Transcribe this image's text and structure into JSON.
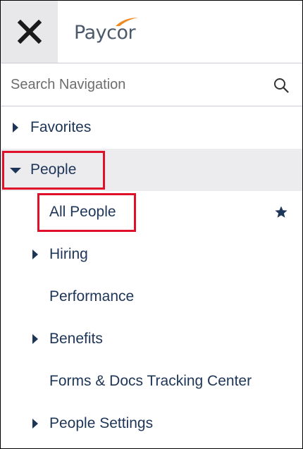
{
  "header": {
    "close_icon": "close-icon",
    "logo_text": "Paycor"
  },
  "search": {
    "placeholder": "Search Navigation",
    "value": "",
    "icon": "search-icon"
  },
  "nav": {
    "favorites": {
      "label": "Favorites",
      "icon": "caret-right-icon"
    },
    "people": {
      "label": "People",
      "icon": "caret-down-icon",
      "expanded": true,
      "active": true
    },
    "children": {
      "all_people": {
        "label": "All People",
        "favorited": true,
        "icon": "star-icon"
      },
      "hiring": {
        "label": "Hiring",
        "icon": "caret-right-icon"
      },
      "performance": {
        "label": "Performance"
      },
      "benefits": {
        "label": "Benefits",
        "icon": "caret-right-icon"
      },
      "forms_docs": {
        "label": "Forms & Docs Tracking Center"
      },
      "people_settings": {
        "label": "People Settings",
        "icon": "caret-right-icon"
      }
    }
  },
  "colors": {
    "text": "#1d3557",
    "highlight": "#e0102a",
    "active_row": "#ececee",
    "close_bg": "#e8e8eb",
    "logo_accent": "#f08a24"
  }
}
